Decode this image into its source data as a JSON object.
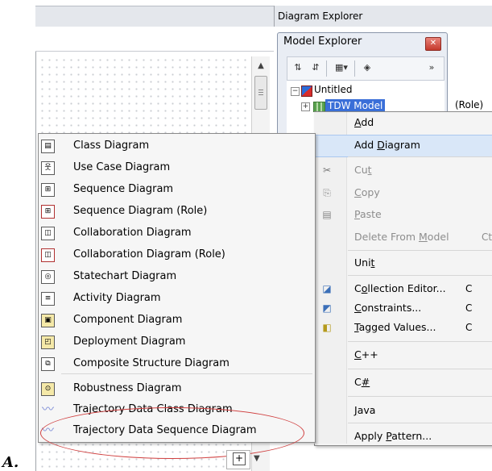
{
  "diagram_explorer": {
    "title": "Diagram Explorer"
  },
  "model_explorer": {
    "title": "Model Explorer",
    "close_icon": "close-icon",
    "toolbar_icons": [
      "sort-asc-icon",
      "sort-desc-icon",
      "view-options-icon",
      "filter-icon",
      "overflow-icon"
    ],
    "tree": [
      {
        "label": "Untitled",
        "icon": "model-cube-icon",
        "expanded": true
      },
      {
        "label": "TDW Model",
        "icon": "package-icon",
        "selected": true,
        "suffix": "(Role)"
      }
    ]
  },
  "context_menu": {
    "items": [
      {
        "label": "Add",
        "u": "A",
        "disabled": false
      },
      {
        "label": "Add Diagram",
        "u": "D",
        "disabled": false,
        "highlighted": true
      },
      {
        "label": "Cut",
        "u": "t",
        "icon": "scissors-icon",
        "disabled": true
      },
      {
        "label": "Copy",
        "u": "C",
        "icon": "copy-icon",
        "disabled": true
      },
      {
        "label": "Paste",
        "u": "P",
        "icon": "paste-icon",
        "disabled": true
      },
      {
        "label": "Delete From Model",
        "u": "M",
        "shortcut": "Ct",
        "disabled": true
      },
      {
        "label": "Unit",
        "u": "t",
        "disabled": false
      },
      {
        "label": "Collection Editor...",
        "u": "o",
        "icon": "collection-editor-icon",
        "shortcut": "C",
        "disabled": false
      },
      {
        "label": "Constraints...",
        "u": "C",
        "icon": "constraints-icon",
        "shortcut": "C",
        "disabled": false
      },
      {
        "label": "Tagged Values...",
        "u": "T",
        "icon": "tagged-values-icon",
        "shortcut": "C",
        "disabled": false
      },
      {
        "label": "C++",
        "u": "C",
        "disabled": false
      },
      {
        "label": "C#",
        "u": "#",
        "disabled": false
      },
      {
        "label": "Java",
        "u": "J",
        "disabled": false
      },
      {
        "label": "Apply Pattern...",
        "u": "P",
        "disabled": false
      }
    ]
  },
  "submenu": {
    "items": [
      {
        "label": "Class Diagram",
        "icon": "class-diagram-icon"
      },
      {
        "label": "Use Case Diagram",
        "icon": "use-case-diagram-icon"
      },
      {
        "label": "Sequence Diagram",
        "icon": "sequence-diagram-icon"
      },
      {
        "label": "Sequence Diagram (Role)",
        "icon": "sequence-role-diagram-icon"
      },
      {
        "label": "Collaboration Diagram",
        "icon": "collaboration-diagram-icon"
      },
      {
        "label": "Collaboration Diagram (Role)",
        "icon": "collaboration-role-diagram-icon"
      },
      {
        "label": "Statechart Diagram",
        "icon": "statechart-diagram-icon"
      },
      {
        "label": "Activity Diagram",
        "icon": "activity-diagram-icon"
      },
      {
        "label": "Component Diagram",
        "icon": "component-diagram-icon"
      },
      {
        "label": "Deployment Diagram",
        "icon": "deployment-diagram-icon"
      },
      {
        "label": "Composite Structure Diagram",
        "icon": "composite-structure-diagram-icon"
      },
      {
        "label": "Robustness Diagram",
        "icon": "robustness-diagram-icon"
      },
      {
        "label": "Trajectory Data Class Diagram",
        "icon": "trajectory-class-diagram-icon"
      },
      {
        "label": "Trajectory Data Sequence Diagram",
        "icon": "trajectory-sequence-diagram-icon"
      }
    ]
  },
  "figure_label": "A.",
  "colors": {
    "highlight": "#d9e7f8",
    "selection": "#3a6fd8",
    "annotation": "#d04040"
  }
}
